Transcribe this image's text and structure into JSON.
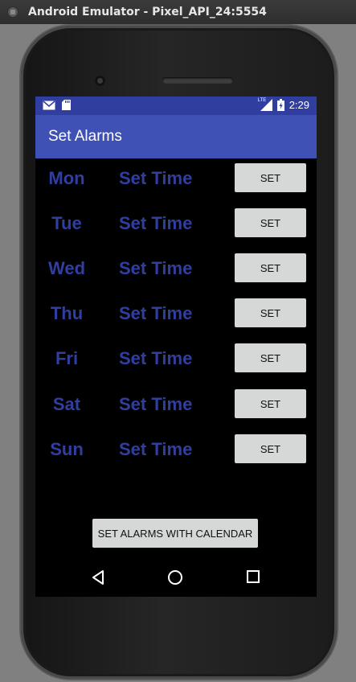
{
  "window": {
    "title": "Android Emulator - Pixel_API_24:5554"
  },
  "statusbar": {
    "time": "2:29",
    "network_label": "LTE",
    "icons": [
      "gmail-icon",
      "sd-card-icon",
      "signal-icon",
      "battery-charging-icon"
    ]
  },
  "appbar": {
    "title": "Set Alarms"
  },
  "alarms": [
    {
      "day": "Mon",
      "time_label": "Set Time",
      "button_label": "SET"
    },
    {
      "day": "Tue",
      "time_label": "Set Time",
      "button_label": "SET"
    },
    {
      "day": "Wed",
      "time_label": "Set Time",
      "button_label": "SET"
    },
    {
      "day": "Thu",
      "time_label": "Set Time",
      "button_label": "SET"
    },
    {
      "day": "Fri",
      "time_label": "Set Time",
      "button_label": "SET"
    },
    {
      "day": "Sat",
      "time_label": "Set Time",
      "button_label": "SET"
    },
    {
      "day": "Sun",
      "time_label": "Set Time",
      "button_label": "SET"
    }
  ],
  "calendar_button": {
    "label": "SET ALARMS WITH CALENDAR"
  },
  "navbar": {
    "icons": [
      "back-icon",
      "home-icon",
      "recents-icon"
    ]
  },
  "colors": {
    "primary": "#3f51b5",
    "primary_dark": "#303f9f",
    "button_bg": "#d6d7d7",
    "screen_bg": "#000000"
  }
}
